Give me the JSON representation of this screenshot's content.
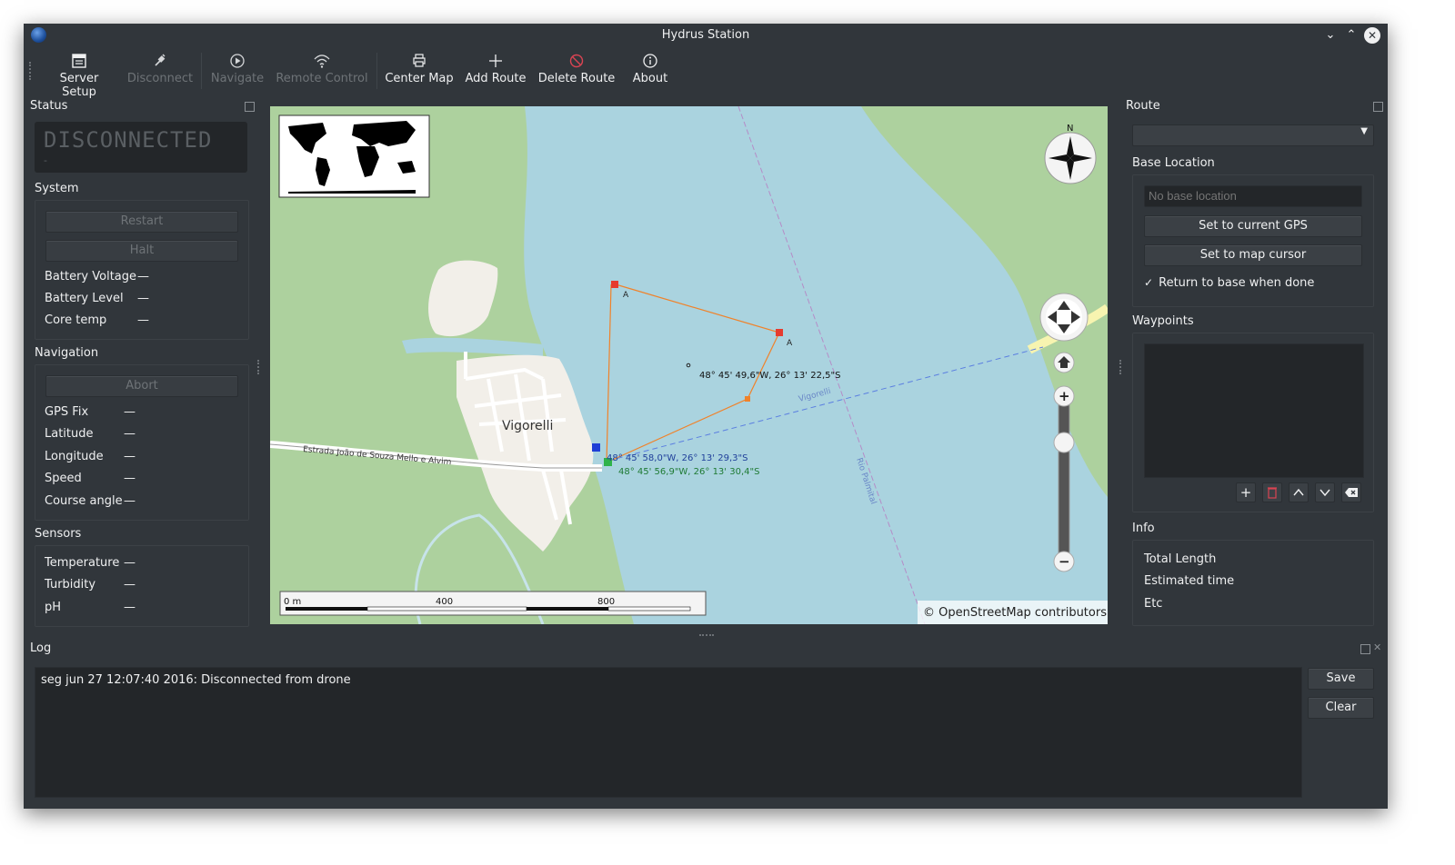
{
  "window": {
    "title": "Hydrus Station"
  },
  "toolbar": [
    {
      "id": "server-setup",
      "label": "Server Setup",
      "icon": "server-setup-icon",
      "enabled": true
    },
    {
      "id": "disconnect",
      "label": "Disconnect",
      "icon": "disconnect-plug-icon",
      "enabled": false
    },
    {
      "id": "navigate",
      "label": "Navigate",
      "icon": "play-circle-icon",
      "enabled": false
    },
    {
      "id": "remote-control",
      "label": "Remote Control",
      "icon": "wifi-icon",
      "enabled": false
    },
    {
      "id": "center-map",
      "label": "Center Map",
      "icon": "printer-icon",
      "enabled": true
    },
    {
      "id": "add-route",
      "label": "Add Route",
      "icon": "plus-icon",
      "enabled": true
    },
    {
      "id": "delete-route",
      "label": "Delete Route",
      "icon": "no-entry-icon",
      "enabled": true
    },
    {
      "id": "about",
      "label": "About",
      "icon": "info-icon",
      "enabled": true
    }
  ],
  "status": {
    "title": "Status",
    "display_text": "DISCONNECTED",
    "display_sub": "-",
    "system": {
      "title": "System",
      "restart_label": "Restart",
      "halt_label": "Halt",
      "fields": [
        {
          "label": "Battery Voltage",
          "value": "—"
        },
        {
          "label": "Battery Level",
          "value": "—"
        },
        {
          "label": "Core temp",
          "value": "—"
        }
      ]
    },
    "navigation": {
      "title": "Navigation",
      "abort_label": "Abort",
      "fields": [
        {
          "label": "GPS Fix",
          "value": "—"
        },
        {
          "label": "Latitude",
          "value": "—"
        },
        {
          "label": "Longitude",
          "value": "—"
        },
        {
          "label": "Speed",
          "value": "—"
        },
        {
          "label": "Course angle",
          "value": "—"
        }
      ]
    },
    "sensors": {
      "title": "Sensors",
      "fields": [
        {
          "label": "Temperature",
          "value": "—"
        },
        {
          "label": "Turbidity",
          "value": "—"
        },
        {
          "label": "pH",
          "value": "—"
        }
      ]
    }
  },
  "map": {
    "town_label": "Vigorelli",
    "road_label": "Estrada João de Souza Mello e Alvim",
    "river_label": "Rio Palmital",
    "route_label": "Vigorelli",
    "compass_label": "N",
    "waypoint_labels": [
      "A",
      "A"
    ],
    "coords": {
      "cursor": "48° 45' 49,6\"W,  26° 13' 22,5\"S",
      "drone": "48° 45' 58,0\"W,  26° 13' 29,3\"S",
      "base": "48° 45' 56,9\"W,  26° 13' 30,4\"S"
    },
    "scale_labels": [
      "0 m",
      "400",
      "800"
    ],
    "attribution": "© OpenStreetMap contributors",
    "zoom_in": "+",
    "zoom_out": "−",
    "colors": {
      "water": "#aad3df",
      "land": "#add19e",
      "town": "#f2efe9",
      "route": "#f0822a",
      "waypoint": "#e63b2e",
      "drone": "#1f3fd6",
      "base": "#2fb34a"
    }
  },
  "route": {
    "title": "Route",
    "combo_value": "",
    "base_location": {
      "title": "Base Location",
      "placeholder": "No base location",
      "set_gps_label": "Set to current GPS",
      "set_cursor_label": "Set to map cursor",
      "return_label": "Return to base when done",
      "return_checked": true
    },
    "waypoints": {
      "title": "Waypoints"
    },
    "info": {
      "title": "Info",
      "rows": [
        "Total Length",
        "Estimated time",
        "Etc"
      ]
    }
  },
  "log": {
    "title": "Log",
    "lines": [
      "seg jun 27 12:07:40 2016: Disconnected from drone"
    ],
    "save_label": "Save",
    "clear_label": "Clear"
  }
}
